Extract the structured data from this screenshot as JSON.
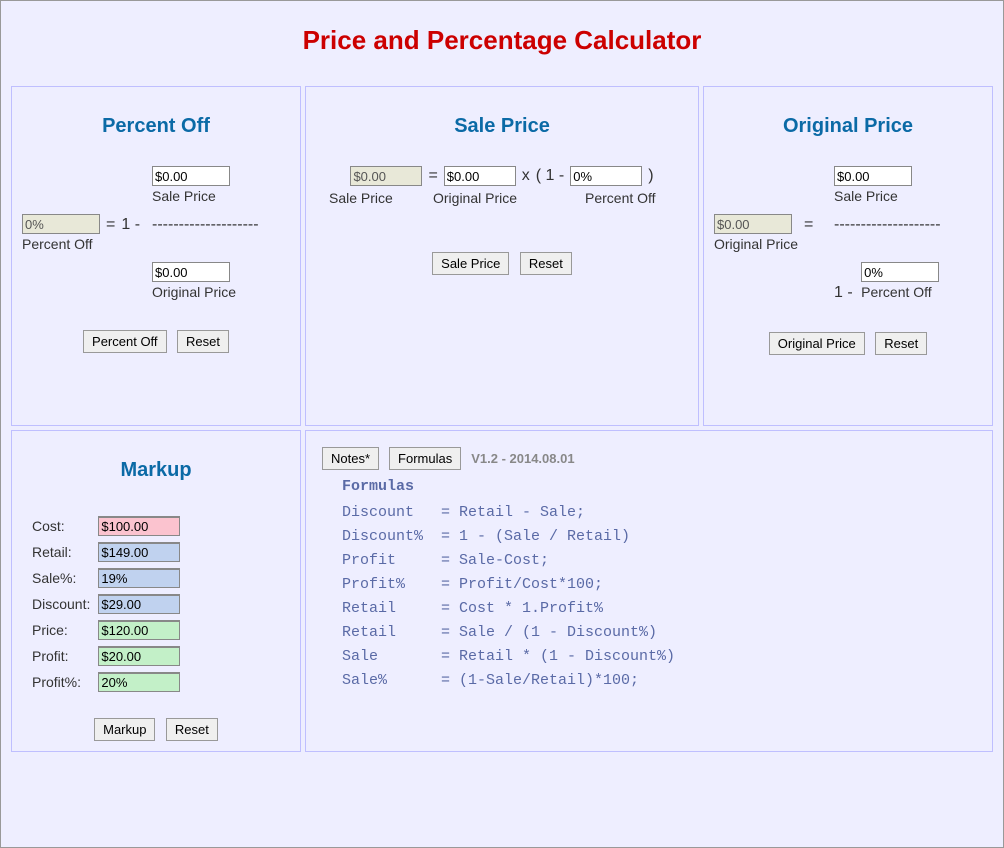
{
  "title": "Price and Percentage Calculator",
  "percentOff": {
    "heading": "Percent Off",
    "salePrice": "$0.00",
    "salePriceLabel": "Sale Price",
    "percentOff": "0%",
    "percentOffLabel": "Percent Off",
    "equals": "=",
    "oneMinus": "1 -",
    "dashes": "--------------------",
    "originalPrice": "$0.00",
    "originalPriceLabel": "Original Price",
    "calcButton": "Percent Off",
    "resetButton": "Reset"
  },
  "salePrice": {
    "heading": "Sale Price",
    "salePrice": "$0.00",
    "salePriceLabel": "Sale Price",
    "equals": "=",
    "originalPrice": "$0.00",
    "originalPriceLabel": "Original Price",
    "times": "x",
    "openParen": "( 1 -",
    "percentOff": "0%",
    "percentOffLabel": "Percent Off",
    "closeParen": ")",
    "calcButton": "Sale Price",
    "resetButton": "Reset"
  },
  "originalPrice": {
    "heading": "Original Price",
    "salePrice": "$0.00",
    "salePriceLabel": "Sale Price",
    "originalPrice": "$0.00",
    "originalPriceLabel": "Original Price",
    "equals": "=",
    "dashes": "--------------------",
    "oneMinus": "1 -",
    "percentOff": "0%",
    "percentOffLabel": "Percent Off",
    "calcButton": "Original Price",
    "resetButton": "Reset"
  },
  "markup": {
    "heading": "Markup",
    "rows": [
      {
        "label": "Cost:",
        "value": "$100.00",
        "cls": "bg-pink"
      },
      {
        "label": "Retail:",
        "value": "$149.00",
        "cls": "bg-lblue"
      },
      {
        "label": "Sale%:",
        "value": "19%",
        "cls": "bg-lblue"
      },
      {
        "label": "Discount:",
        "value": "$29.00",
        "cls": "bg-lblue"
      },
      {
        "label": "Price:",
        "value": "$120.00",
        "cls": "bg-lgreen"
      },
      {
        "label": "Profit:",
        "value": "$20.00",
        "cls": "bg-lgreen"
      },
      {
        "label": "Profit%:",
        "value": "20%",
        "cls": "bg-lgreen"
      }
    ],
    "calcButton": "Markup",
    "resetButton": "Reset"
  },
  "formulasPanel": {
    "notesButton": "Notes*",
    "formulasButton": "Formulas",
    "version": "V1.2 - 2014.08.01",
    "heading": "Formulas",
    "body": "Discount   = Retail - Sale;\nDiscount%  = 1 - (Sale / Retail)\nProfit     = Sale-Cost;\nProfit%    = Profit/Cost*100;\nRetail     = Cost * 1.Profit%\nRetail     = Sale / (1 - Discount%)\nSale       = Retail * (1 - Discount%)\nSale%      = (1-Sale/Retail)*100;"
  }
}
